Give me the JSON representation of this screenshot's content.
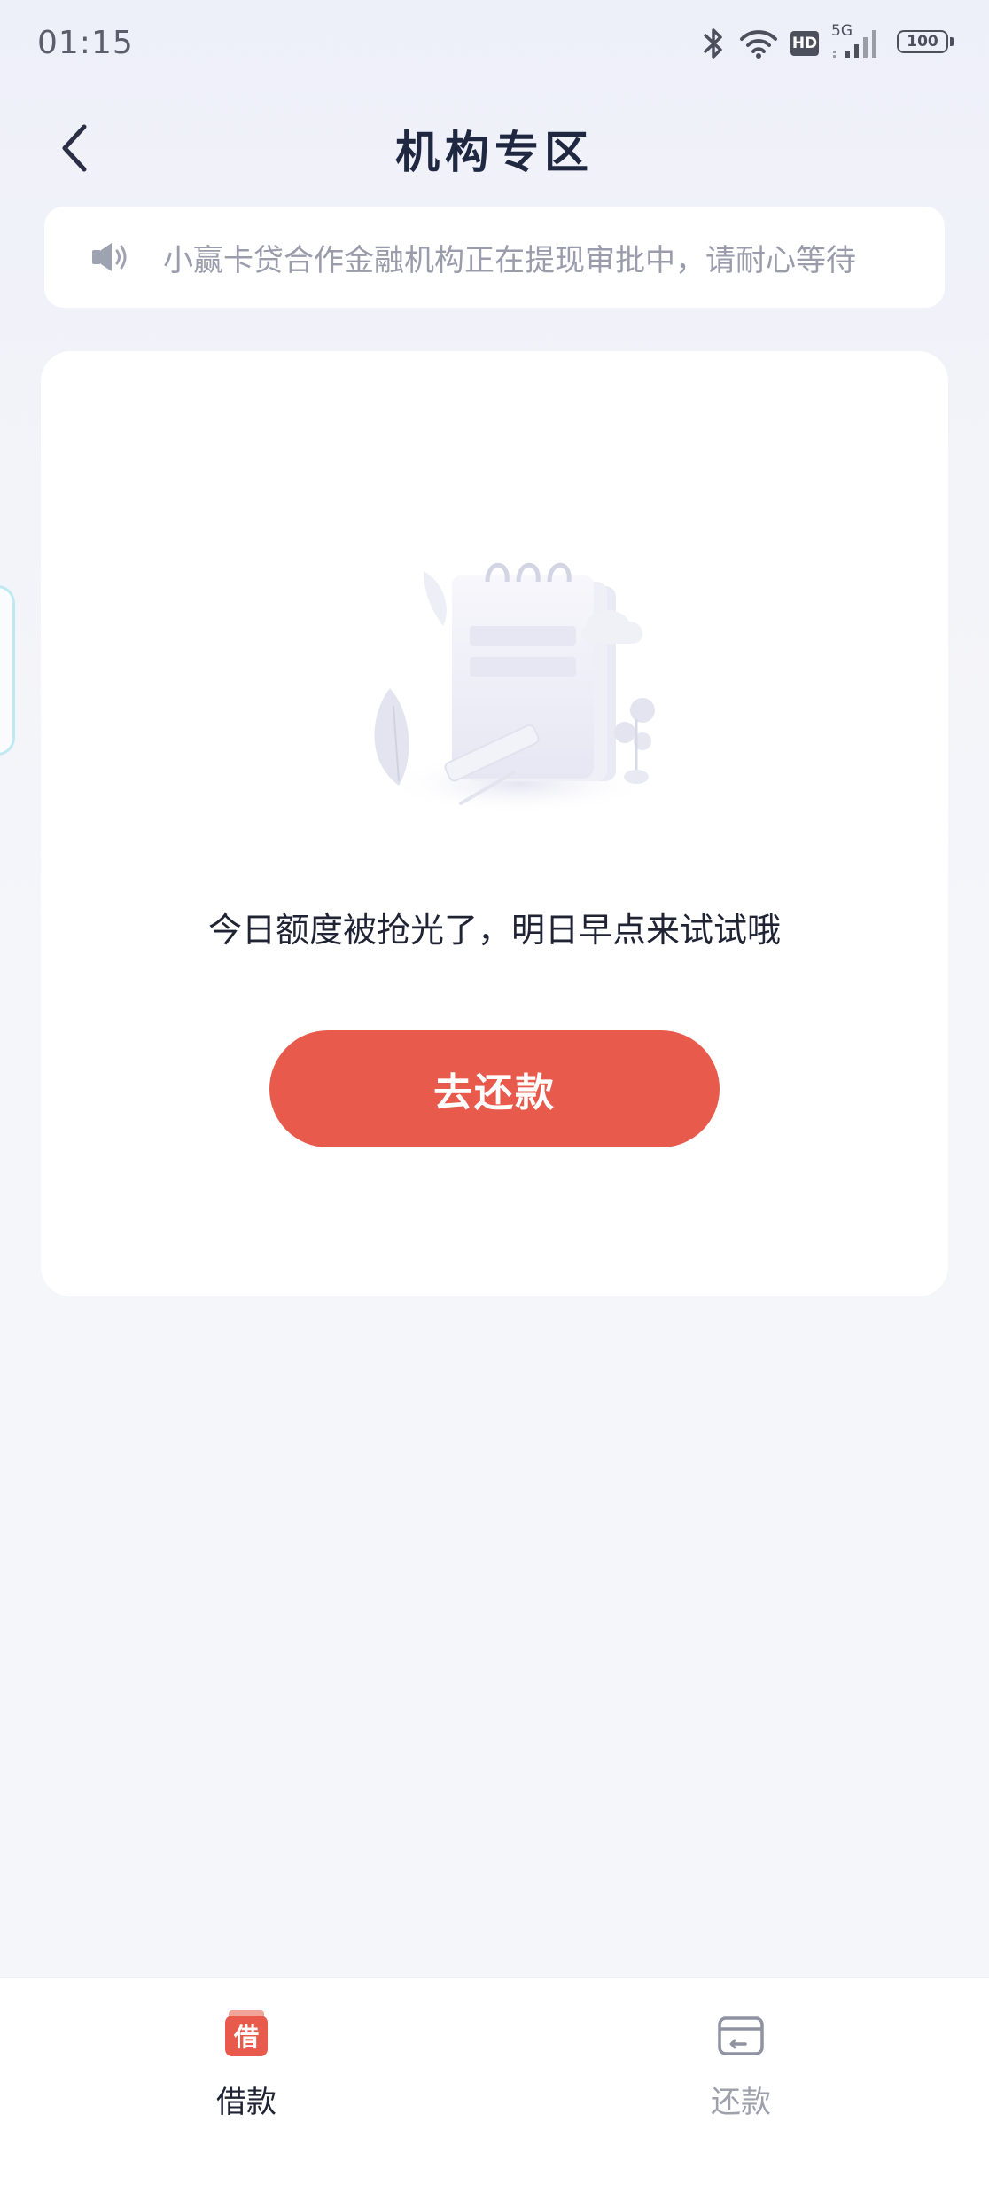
{
  "status_bar": {
    "time": "01:15",
    "battery": "100",
    "network": "5G",
    "hd_label": "HD",
    "icons": [
      "bluetooth-icon",
      "wifi-icon",
      "hd-icon",
      "cellular-signal-icon",
      "battery-icon"
    ]
  },
  "header": {
    "title": "机构专区",
    "back_icon": "chevron-left-icon"
  },
  "notice": {
    "icon": "speaker-icon",
    "text": "小赢卡贷合作金融机构正在提现审批中，请耐心等待"
  },
  "main": {
    "illustration": "empty-notebook-illustration",
    "empty_message": "今日额度被抢光了，明日早点来试试哦",
    "repay_button_label": "去还款",
    "accent_color": "#e85a4b"
  },
  "tab_bar": {
    "tabs": [
      {
        "label": "借款",
        "icon": "borrow-icon",
        "icon_text": "借",
        "active": true
      },
      {
        "label": "还款",
        "icon": "card-icon",
        "active": false
      }
    ]
  }
}
